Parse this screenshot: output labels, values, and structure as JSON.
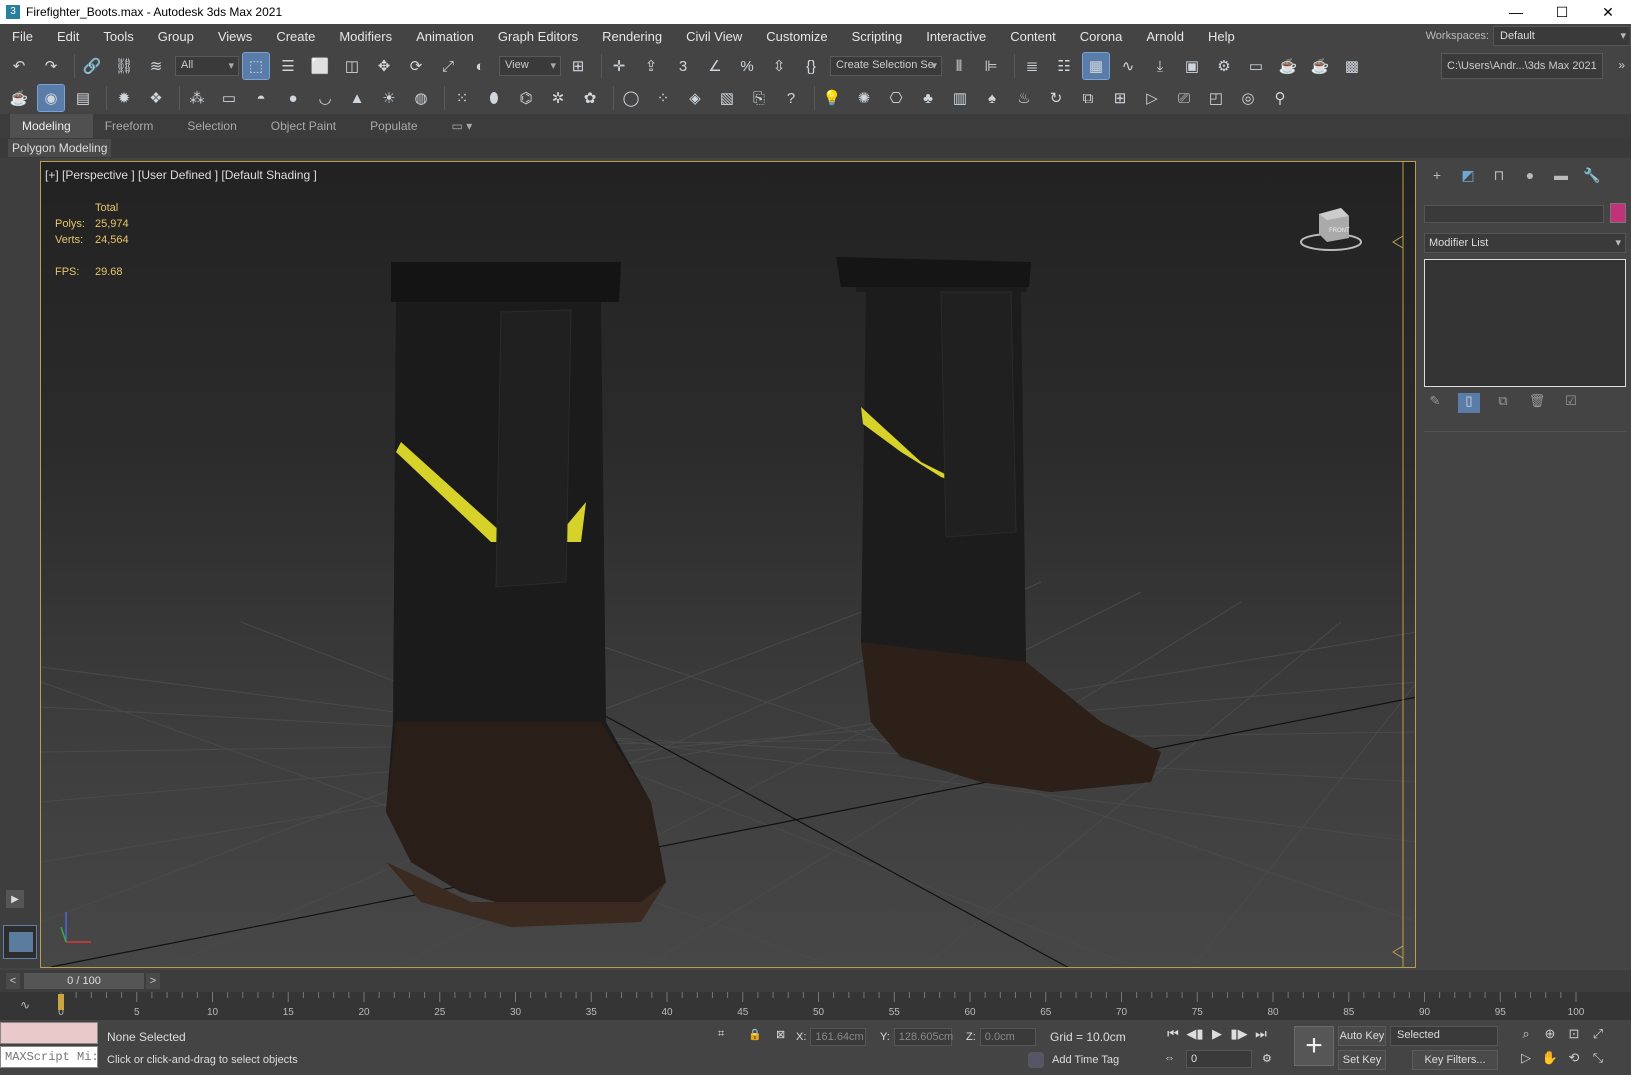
{
  "window": {
    "title": "Firefighter_Boots.max - Autodesk 3ds Max 2021",
    "app_icon": "3"
  },
  "menu": [
    "File",
    "Edit",
    "Tools",
    "Group",
    "Views",
    "Create",
    "Modifiers",
    "Animation",
    "Graph Editors",
    "Rendering",
    "Civil View",
    "Customize",
    "Scripting",
    "Interactive",
    "Content",
    "Corona",
    "Arnold",
    "Help"
  ],
  "workspace": {
    "label": "Workspaces:",
    "value": "Default"
  },
  "toolbar": {
    "filter": "All",
    "refcoord": "View",
    "selection_set": "Create Selection Se",
    "project_path": "C:\\Users\\Andr...\\3ds Max 2021"
  },
  "ribbon": {
    "tabs": [
      "Modeling",
      "Freeform",
      "Selection",
      "Object Paint",
      "Populate"
    ],
    "active_panel": "Polygon Modeling"
  },
  "viewport": {
    "label": "[+] [Perspective ] [User Defined ] [Default Shading ]",
    "stats": {
      "header": "Total",
      "polys_label": "Polys:",
      "polys": "25,974",
      "verts_label": "Verts:",
      "verts": "24,564",
      "fps_label": "FPS:",
      "fps": "29.68"
    },
    "viewcube_face": "FRONT"
  },
  "timeline": {
    "frame": "0 / 100",
    "ticks": [
      "0",
      "5",
      "10",
      "15",
      "20",
      "25",
      "30",
      "35",
      "40",
      "45",
      "50",
      "55",
      "60",
      "65",
      "70",
      "75",
      "80",
      "85",
      "90",
      "95",
      "100"
    ]
  },
  "status": {
    "maxscript": "MAXScript Mi:",
    "selection": "None Selected",
    "prompt": "Click or click-and-drag to select objects",
    "x_label": "X:",
    "x": "161.64cm",
    "y_label": "Y:",
    "y": "128.605cm",
    "z_label": "Z:",
    "z": "0.0cm",
    "grid": "Grid = 10.0cm",
    "add_time_tag": "Add Time Tag",
    "current_frame": "0",
    "auto_key": "Auto Key",
    "set_key": "Set Key",
    "selected": "Selected",
    "key_filters": "Key Filters..."
  },
  "command_panel": {
    "modifier_list": "Modifier List",
    "object_color": "#c0327a"
  },
  "colors": {
    "viewport_border": "#b8a050",
    "stats_text": "#e8c56a",
    "accent": "#5a7ca8"
  }
}
